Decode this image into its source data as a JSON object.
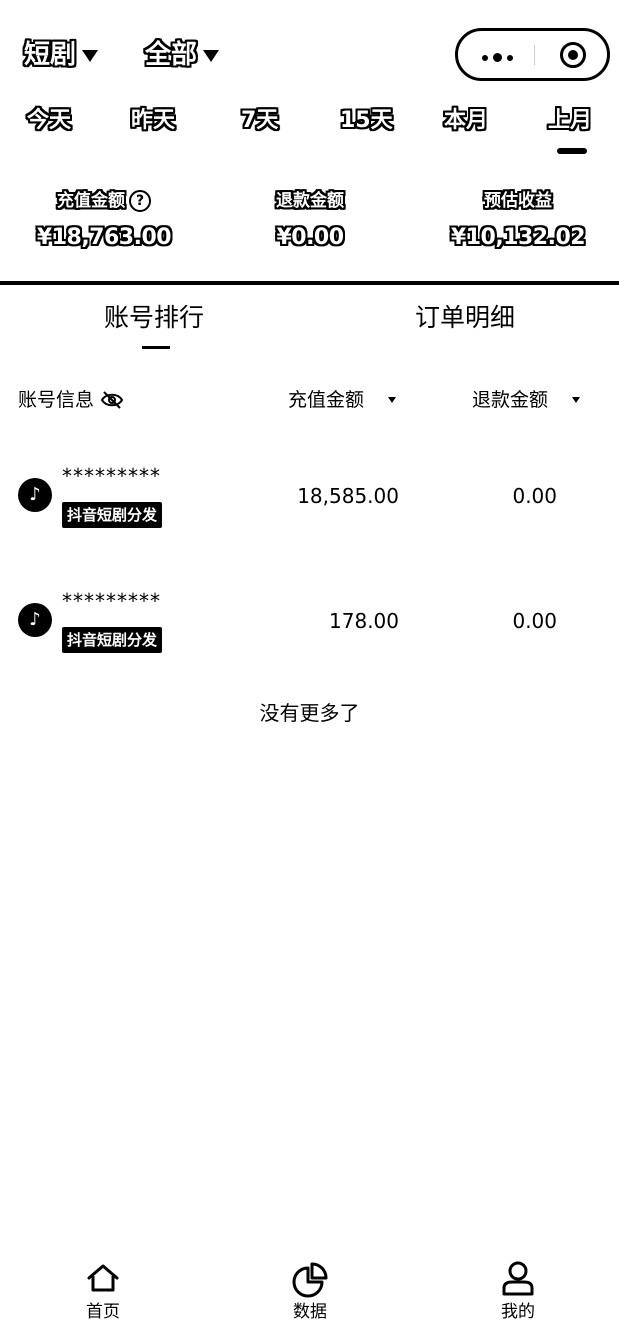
{
  "header": {
    "category_label": "短剧",
    "scope_label": "全部"
  },
  "date_tabs": [
    {
      "label": "今天"
    },
    {
      "label": "昨天"
    },
    {
      "label": "7天"
    },
    {
      "label": "15天"
    },
    {
      "label": "本月"
    },
    {
      "label": "上月",
      "active": true
    }
  ],
  "stats": [
    {
      "label": "充值金额",
      "value": "¥18,763.00",
      "has_help_icon": true
    },
    {
      "label": "退款金额",
      "value": "¥0.00"
    },
    {
      "label": "预估收益",
      "value": "¥10,132.02"
    }
  ],
  "content_tabs": [
    {
      "label": "账号排行",
      "active": true
    },
    {
      "label": "订单明细"
    }
  ],
  "table": {
    "columns": {
      "account": "账号信息",
      "recharge": "充值金额",
      "refund": "退款金额"
    },
    "rows": [
      {
        "account": "*********",
        "platform_tag": "抖音短剧分发",
        "recharge": "18,585.00",
        "refund": "0.00",
        "logo_icon": "douyin-icon"
      },
      {
        "account": "*********",
        "platform_tag": "抖音短剧分发",
        "recharge": "178.00",
        "refund": "0.00",
        "logo_icon": "douyin-icon"
      }
    ],
    "no_more_text": "没有更多了"
  },
  "bottom_nav": [
    {
      "label": "首页",
      "icon": "home-icon"
    },
    {
      "label": "数据",
      "icon": "pie-chart-icon",
      "active": true
    },
    {
      "label": "我的",
      "icon": "user-icon"
    }
  ]
}
